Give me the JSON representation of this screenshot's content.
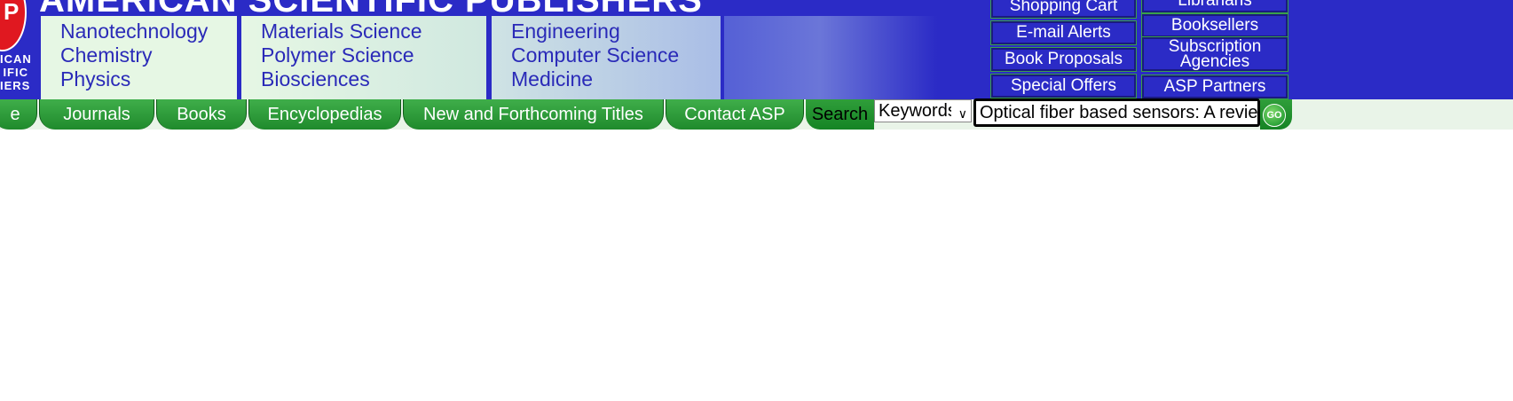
{
  "header": {
    "title": "AMERICAN SCIENTIFIC PUBLISHERS",
    "logo": {
      "letter": "P",
      "text_lines": [
        "ICAN",
        "IFIC",
        "IERS"
      ]
    },
    "subjects": [
      [
        "Nanotechnology",
        "Chemistry",
        "Physics"
      ],
      [
        "Materials Science",
        "Polymer Science",
        "Biosciences"
      ],
      [
        "Engineering",
        "Computer Science",
        "Medicine"
      ]
    ]
  },
  "side_links": {
    "col1": [
      "Shopping Cart",
      "E-mail Alerts",
      "Book Proposals",
      "Special Offers"
    ],
    "col2": [
      "Librarians",
      "Booksellers",
      "Subscription Agencies",
      "ASP Partners"
    ]
  },
  "nav": {
    "tabs": [
      "e",
      "Journals",
      "Books",
      "Encyclopedias",
      "New and Forthcoming Titles",
      "Contact ASP"
    ],
    "search_label": "Search",
    "select_value": "Keywords",
    "search_value": "Optical fiber based sensors: A revie",
    "go_label": "GO"
  },
  "colors": {
    "header_blue": "#2b2bc6",
    "subject_text": "#2a2ab8",
    "nav_green": "#1f8a2c",
    "nav_bar_bg": "#e9f4e8"
  }
}
